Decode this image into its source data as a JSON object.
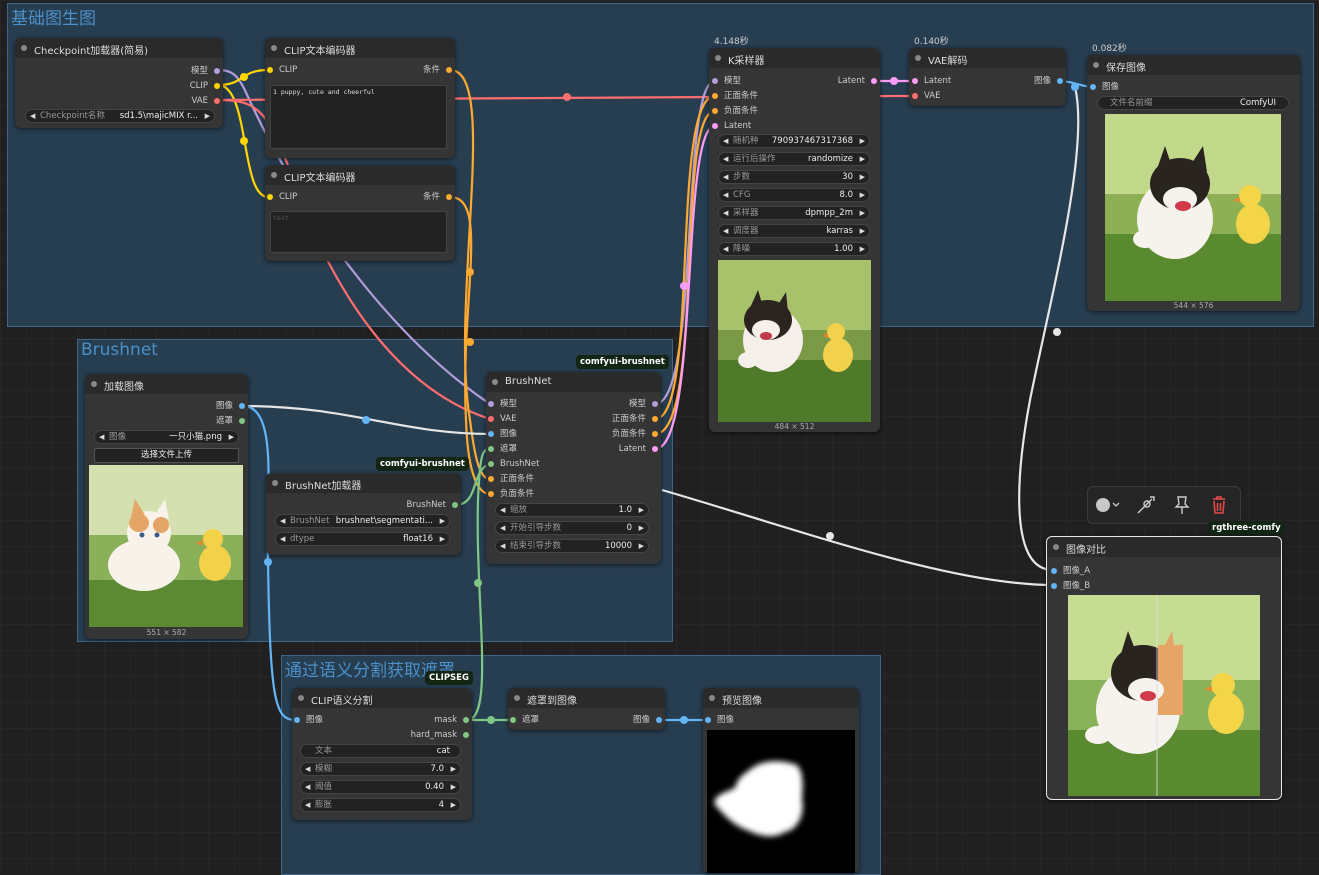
{
  "colors": {
    "model": "#b39ddb",
    "clip": "#ffd500",
    "vae": "#ff6e6e",
    "cond": "#ffa931",
    "latent": "#ff9cf9",
    "image": "#64b5f6",
    "mask": "#81c784",
    "brushnet": "#81c784",
    "group_bg": "#2a4862",
    "node_bg": "#353535"
  },
  "groups": {
    "basic": "基础图生图",
    "brushnet": "Brushnet",
    "seg": "通过语义分割获取遮罩"
  },
  "checkpoint": {
    "title": "Checkpoint加载器(简易)",
    "outputs": [
      "模型",
      "CLIP",
      "VAE"
    ],
    "ckpt_label": "Checkpoint名称",
    "ckpt_value": "sd1.5\\majicMIX r..."
  },
  "clip_pos": {
    "title": "CLIP文本编码器",
    "input": "CLIP",
    "output": "条件",
    "text": "1 puppy, cute and cheerful"
  },
  "clip_neg": {
    "title": "CLIP文本编码器",
    "input": "CLIP",
    "output": "条件",
    "placeholder": "text"
  },
  "ksampler": {
    "timing": "4.148秒",
    "title": "K采样器",
    "inputs": [
      "模型",
      "正面条件",
      "负面条件",
      "Latent"
    ],
    "output": "Latent",
    "widgets": [
      {
        "label": "随机种",
        "value": "790937467317368"
      },
      {
        "label": "运行后操作",
        "value": "randomize"
      },
      {
        "label": "步数",
        "value": "30"
      },
      {
        "label": "CFG",
        "value": "8.0"
      },
      {
        "label": "采样器",
        "value": "dpmpp_2m"
      },
      {
        "label": "调度器",
        "value": "karras"
      },
      {
        "label": "降噪",
        "value": "1.00"
      }
    ],
    "size": "484 × 512"
  },
  "vae_decode": {
    "timing": "0.140秒",
    "title": "VAE解码",
    "inputs": [
      "Latent",
      "VAE"
    ],
    "output": "图像"
  },
  "save_image": {
    "timing": "0.082秒",
    "title": "保存图像",
    "input": "图像",
    "prefix_label": "文件名前缀",
    "prefix_value": "ComfyUI",
    "size": "544 × 576"
  },
  "load_image": {
    "title": "加载图像",
    "outputs": [
      "图像",
      "遮罩"
    ],
    "image_label": "图像",
    "image_value": "一只小猫.png",
    "upload": "选择文件上传",
    "size": "551 × 582"
  },
  "brushnet_loader": {
    "badge": "comfyui-brushnet",
    "title": "BrushNet加载器",
    "output": "BrushNet",
    "widgets": [
      {
        "label": "BrushNet",
        "value": "brushnet\\segmentati..."
      },
      {
        "label": "dtype",
        "value": "float16"
      }
    ]
  },
  "brushnet": {
    "badge": "comfyui-brushnet",
    "title": "BrushNet",
    "inputs": [
      "模型",
      "VAE",
      "图像",
      "遮罩",
      "BrushNet",
      "正面条件",
      "负面条件"
    ],
    "outputs": [
      "模型",
      "正面条件",
      "负面条件",
      "Latent"
    ],
    "widgets": [
      {
        "label": "缩放",
        "value": "1.0"
      },
      {
        "label": "开始引导步数",
        "value": "0"
      },
      {
        "label": "结束引导步数",
        "value": "10000"
      }
    ]
  },
  "clipseg": {
    "badge": "CLIPSEG",
    "title": "CLIP语义分割",
    "input": "图像",
    "outputs": [
      "mask",
      "hard_mask"
    ],
    "widgets": [
      {
        "label": "文本",
        "value": "cat"
      },
      {
        "label": "模糊",
        "value": "7.0"
      },
      {
        "label": "阈值",
        "value": "0.40"
      },
      {
        "label": "膨胀",
        "value": "4"
      }
    ]
  },
  "mask_to_image": {
    "title": "遮罩到图像",
    "input": "遮罩",
    "output": "图像"
  },
  "preview": {
    "title": "预览图像",
    "input": "图像"
  },
  "compare": {
    "badge": "rgthree-comfy",
    "title": "图像对比",
    "inputs": [
      "图像_A",
      "图像_B"
    ]
  },
  "toolbar": {
    "icons": [
      "color-icon",
      "bypass-icon",
      "pin-icon",
      "delete-icon"
    ]
  }
}
